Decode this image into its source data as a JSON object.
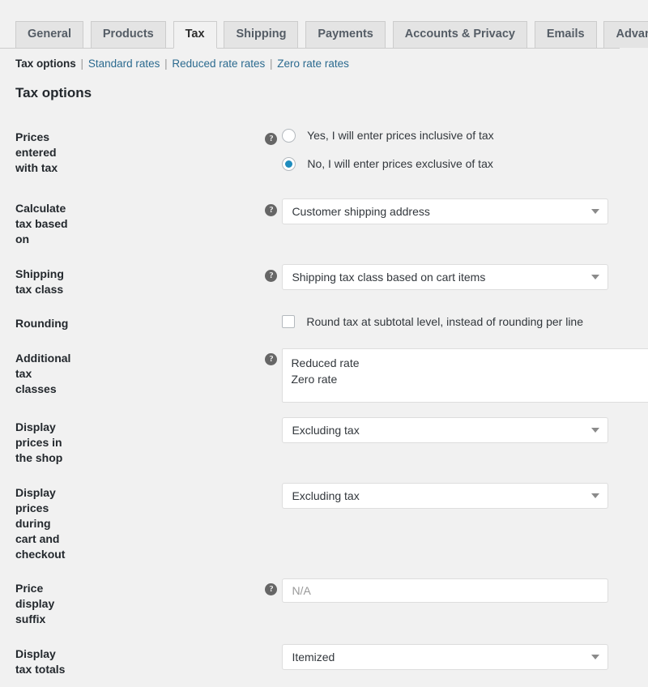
{
  "tabs": [
    {
      "label": "General",
      "active": false
    },
    {
      "label": "Products",
      "active": false
    },
    {
      "label": "Tax",
      "active": true
    },
    {
      "label": "Shipping",
      "active": false
    },
    {
      "label": "Payments",
      "active": false
    },
    {
      "label": "Accounts & Privacy",
      "active": false
    },
    {
      "label": "Emails",
      "active": false
    },
    {
      "label": "Advanced",
      "active": false
    }
  ],
  "subnav": {
    "current": "Tax options",
    "links": [
      "Standard rates",
      "Reduced rate rates",
      "Zero rate rates"
    ],
    "separator": "|"
  },
  "heading": "Tax options",
  "help_glyph": "?",
  "colors": {
    "page_background": "#f1f1f1",
    "tab_inactive_background": "#e4e4e4",
    "tab_active_background": "#f1f1f1",
    "border": "#cccccc",
    "input_border": "#dddddd",
    "link": "#2b6a8f",
    "label_text": "#23282d",
    "radio_selected": "#1e8cbe",
    "help_icon_background": "#666666",
    "arrow": "#8a8a8a"
  },
  "rows": {
    "prices_entered_with_tax": {
      "label": "Prices entered with tax",
      "options": [
        {
          "label": "Yes, I will enter prices inclusive of tax",
          "selected": false
        },
        {
          "label": "No, I will enter prices exclusive of tax",
          "selected": true
        }
      ]
    },
    "calculate_tax_based_on": {
      "label": "Calculate tax based on",
      "value": "Customer shipping address"
    },
    "shipping_tax_class": {
      "label": "Shipping tax class",
      "value": "Shipping tax class based on cart items"
    },
    "rounding": {
      "label": "Rounding",
      "checkbox_label": "Round tax at subtotal level, instead of rounding per line",
      "checked": false
    },
    "additional_tax_classes": {
      "label": "Additional tax classes",
      "value": "Reduced rate\nZero rate"
    },
    "display_prices_in_the_shop": {
      "label": "Display prices in the shop",
      "value": "Excluding tax"
    },
    "display_prices_during_cart_and_checkout": {
      "label": "Display prices during cart and checkout",
      "value": "Excluding tax"
    },
    "price_display_suffix": {
      "label": "Price display suffix",
      "value": "",
      "placeholder": "N/A"
    },
    "display_tax_totals": {
      "label": "Display tax totals",
      "value": "Itemized"
    }
  }
}
